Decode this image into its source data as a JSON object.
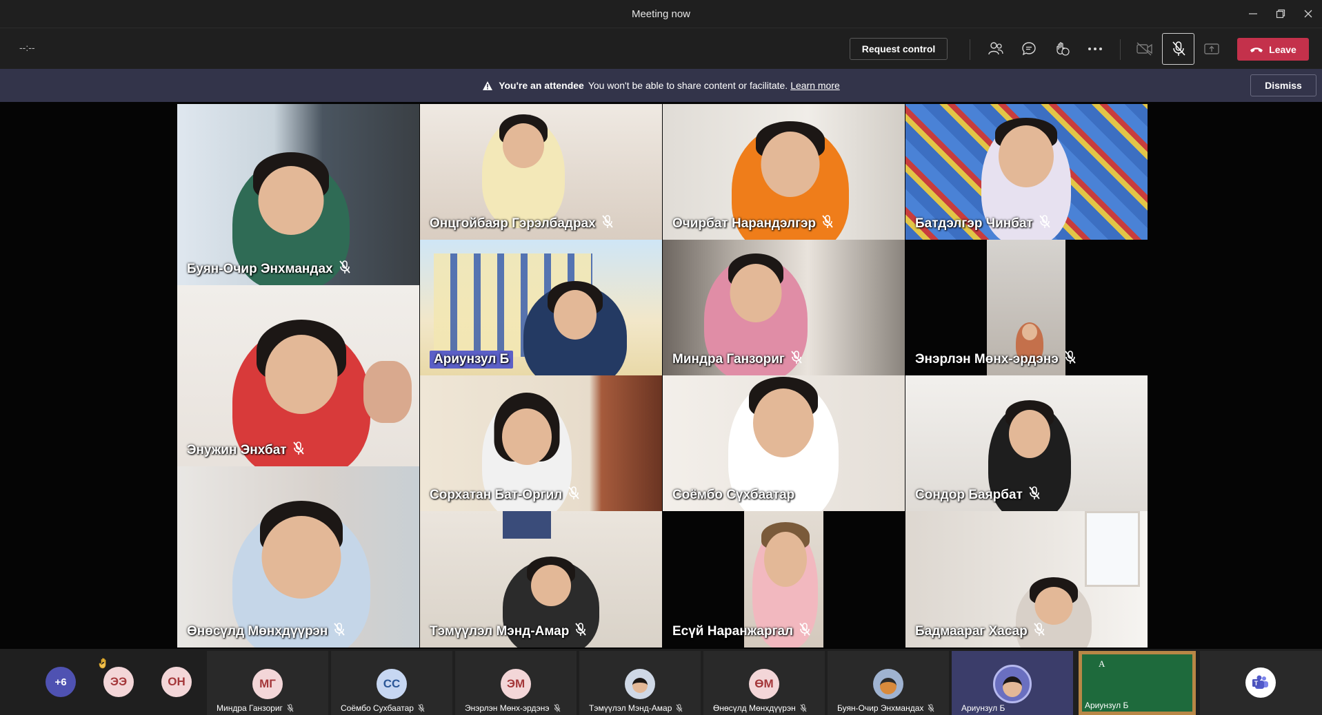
{
  "window": {
    "title": "Meeting now"
  },
  "toolbar": {
    "timer": "--:--",
    "request_control_label": "Request control",
    "leave_label": "Leave",
    "icons": [
      "people-icon",
      "chat-icon",
      "reactions-icon",
      "more-icon",
      "camera-off-icon",
      "mic-off-icon",
      "share-icon",
      "phone-icon"
    ]
  },
  "banner": {
    "title": "You're an attendee",
    "message": "You won't be able to share content or facilitate.",
    "link": "Learn more",
    "dismiss_label": "Dismiss"
  },
  "tiles": [
    {
      "name": "Буян-Очир Энхмандах"
    },
    {
      "name": "Онцгойбаяр Гэрэлбадрах"
    },
    {
      "name": "Очирбат Нарандэлгэр"
    },
    {
      "name": "Батдэлгэр Чинбат"
    },
    {
      "name": "Ариунзул Б"
    },
    {
      "name": "Миндра Ганзориг"
    },
    {
      "name": "Энэрлэн Мөнх-эрдэнэ"
    },
    {
      "name": "Энужин Энхбат"
    },
    {
      "name": "Сорхатан Бат-Оргил"
    },
    {
      "name": "Соёмбо Сүхбаатар"
    },
    {
      "name": "Сондор Баярбат"
    },
    {
      "name": "Өнөсүлд Мөнхдүүрэн"
    },
    {
      "name": "Тэмүүлэл Мэнд-Амар"
    },
    {
      "name": "Есүй Наранжаргал"
    },
    {
      "name": "Бадмаараг Хасар"
    }
  ],
  "roster": {
    "overflow_count": "+6",
    "avatars": [
      {
        "initials": "ЭЭ",
        "color": "#f3d6d8",
        "text_color": "#a4373a",
        "raised_hand": true
      },
      {
        "initials": "ОН",
        "color": "#f3d6d8",
        "text_color": "#a4373a",
        "raised_hand": false
      }
    ],
    "participants": [
      {
        "initials": "МГ",
        "name": "Миндра Ганзориг",
        "color": "#f3d6d8",
        "text_color": "#a4373a"
      },
      {
        "initials": "СС",
        "name": "Соёмбо Сухбаатар",
        "color": "#c7d7f2",
        "text_color": "#2b5797"
      },
      {
        "initials": "ЭМ",
        "name": "Энэрлэн Мөнх-эрдэнэ",
        "color": "#f3d6d8",
        "text_color": "#a4373a"
      },
      {
        "initials": "",
        "name": "Тэмүүлэл Мэнд-Амар",
        "color": "#cfd8e6",
        "text_color": "#333"
      },
      {
        "initials": "ӨМ",
        "name": "Өнөсүлд Мөнхдүүрэн",
        "color": "#f3d6d8",
        "text_color": "#a4373a"
      },
      {
        "initials": "",
        "name": "Буян-Очир Энхмандах",
        "color": "#9fb3d1",
        "text_color": "#333"
      },
      {
        "initials": "",
        "name": "Ариунзул Б",
        "color": "#6a6fc0",
        "text_color": "#fff"
      }
    ],
    "shared_content_name": "Ариунзул Б",
    "shared_content_letter": "A"
  }
}
